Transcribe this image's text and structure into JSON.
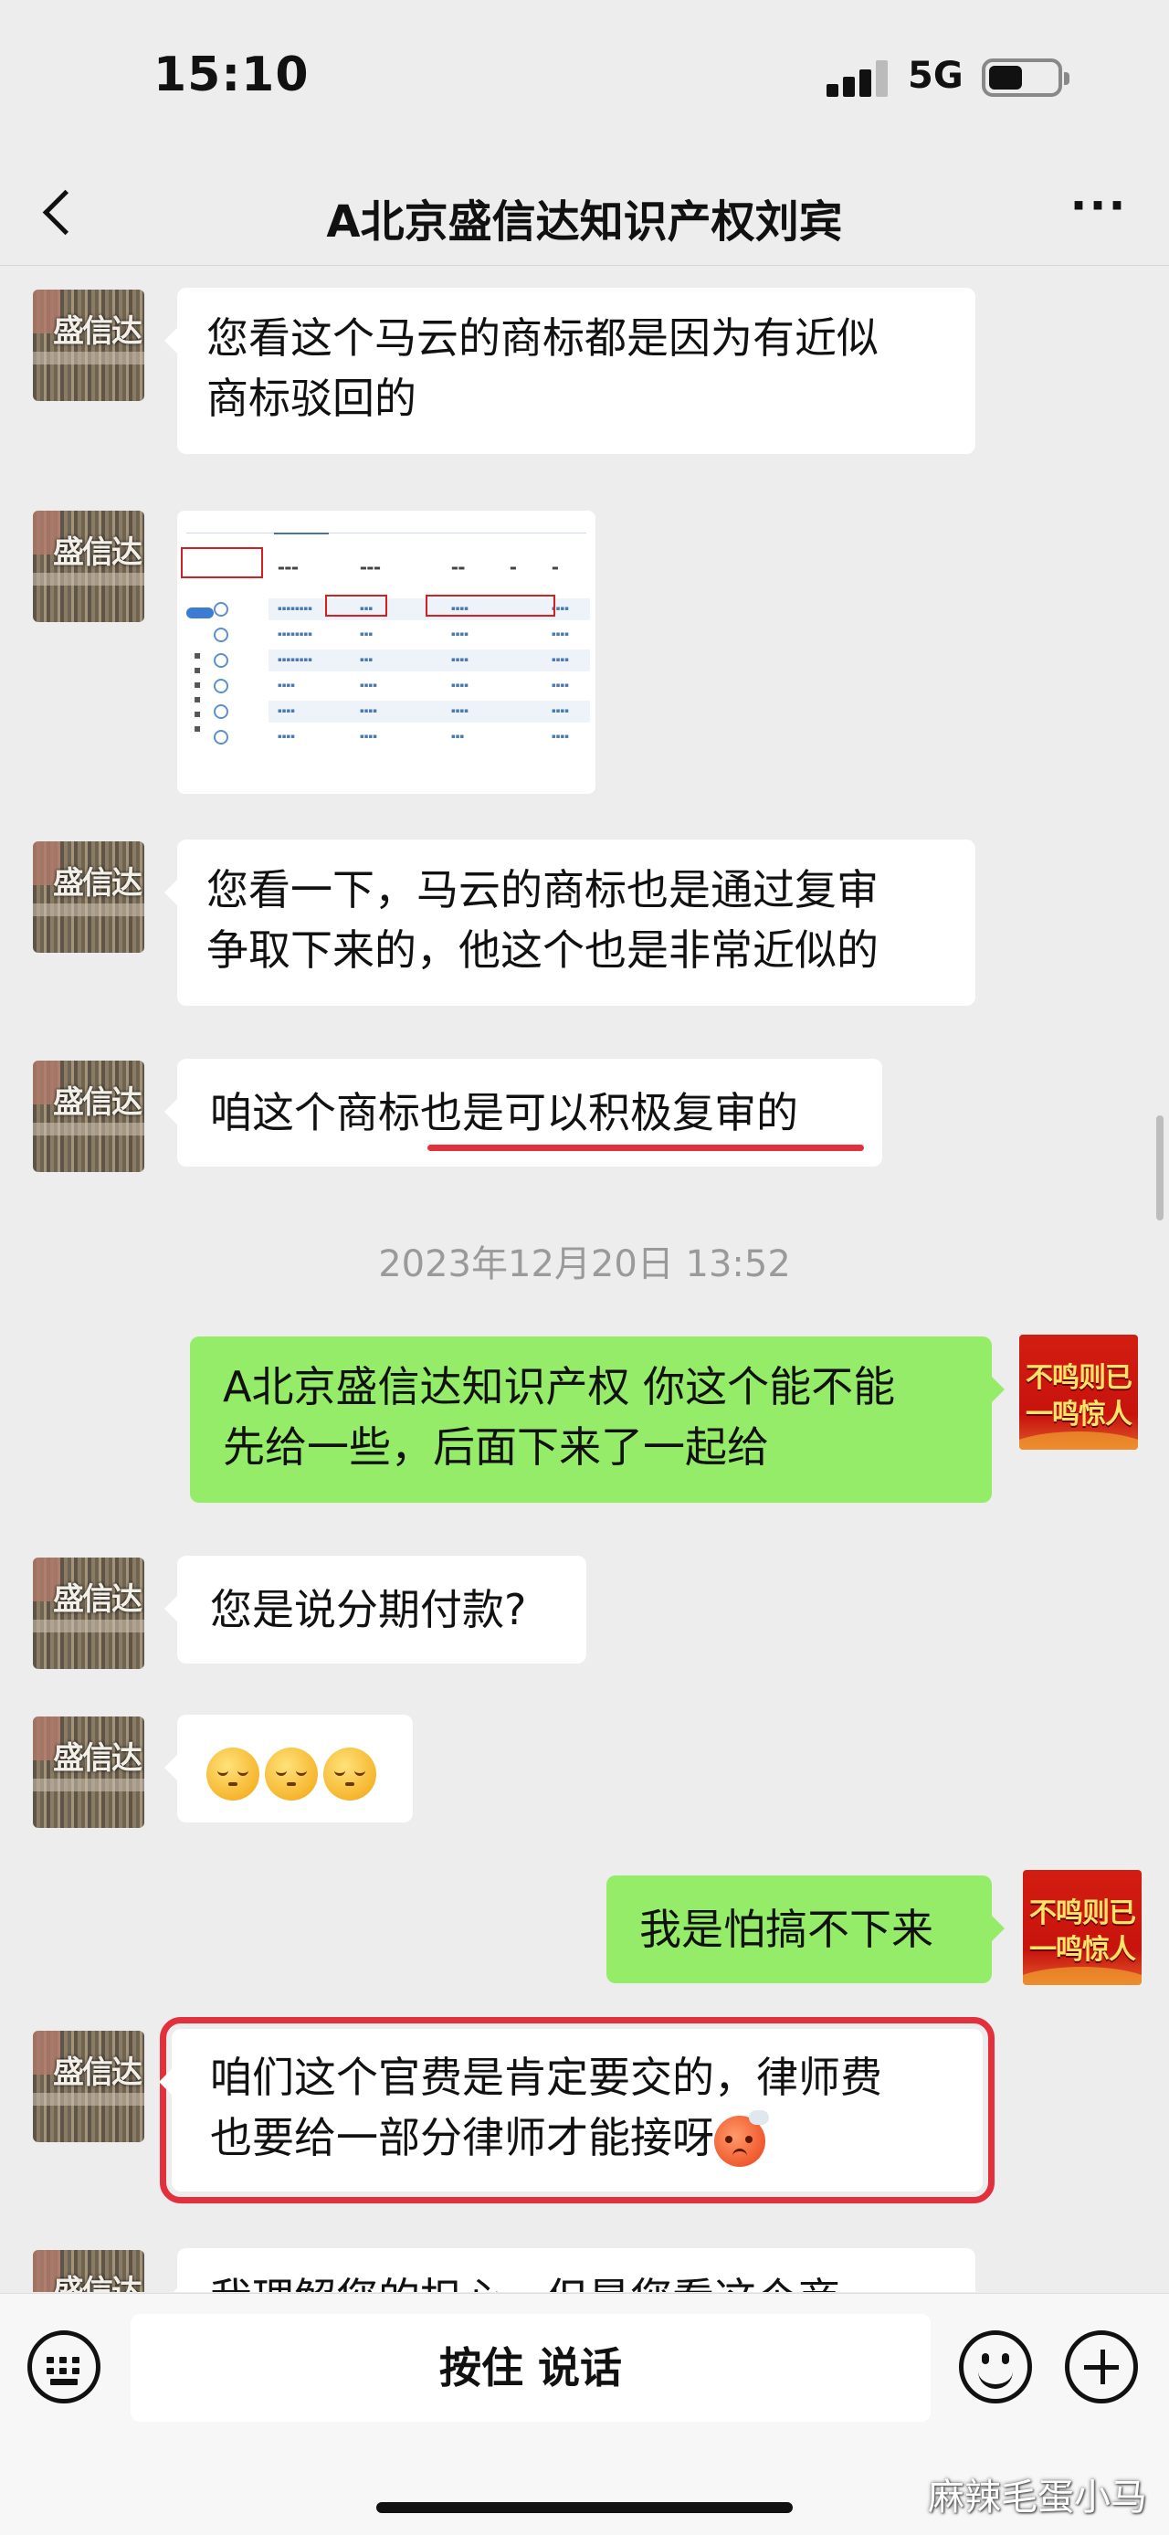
{
  "status_bar": {
    "time": "15:10",
    "network": "5G"
  },
  "nav": {
    "title": "A北京盛信达知识产权刘宾",
    "more_label": "···"
  },
  "avatars": {
    "agent_text": "盛信达",
    "me_line1": "不鸣则已",
    "me_line2": "一鸣惊人"
  },
  "messages": {
    "m1_line1": "您看这个马云的商标都是因为有近似",
    "m1_line2": "商标驳回的",
    "m3_line1": "您看一下，马云的商标也是通过复审",
    "m3_line2": "争取下来的，他这个也是非常近似的",
    "m4": "咱这个商标也是可以积极复审的",
    "timestamp": "2023年12月20日 13:52",
    "m5_line1": "A北京盛信达知识产权 你这个能不能",
    "m5_line2": "先给一些，后面下来了一起给",
    "m6": "您是说分期付款?",
    "m8": "我是怕搞不下来",
    "m9_line1": "咱们这个官费是肯定要交的，律师费",
    "m9_line2": "也要给一部分律师才能接呀",
    "m10_partial": "我理解您的担心，但是您看这个商"
  },
  "bottom": {
    "hold_to_talk": "按住 说话",
    "watermark": "麻辣毛蛋小马"
  }
}
